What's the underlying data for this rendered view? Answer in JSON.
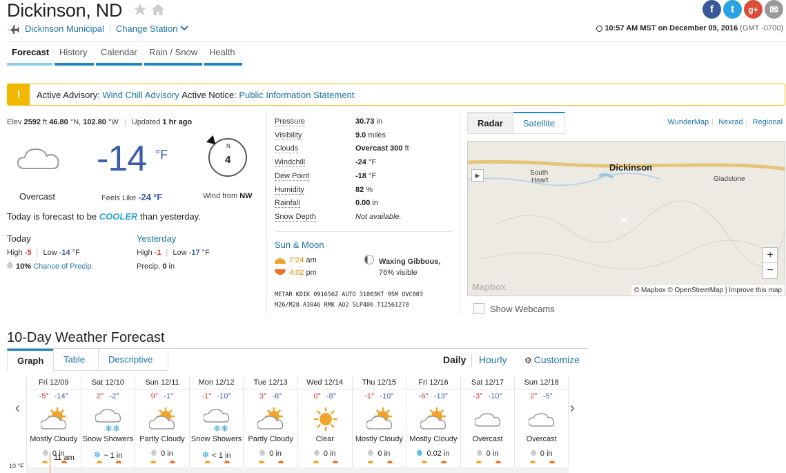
{
  "header": {
    "city": "Dickinson, ND",
    "station": "Dickinson Municipal",
    "change_station": "Change Station",
    "timestamp": "10:57 AM MST on December 09, 2016",
    "gmt": "(GMT -0700)"
  },
  "social": [
    "f",
    "t",
    "g+",
    "✉"
  ],
  "tabs": [
    "Forecast",
    "History",
    "Calendar",
    "Rain / Snow",
    "Health"
  ],
  "advisory": {
    "label1": "Active Advisory:",
    "link1": "Wind Chill Advisory",
    "label2": "Active Notice:",
    "link2": "Public Information Statement"
  },
  "current": {
    "elev_label": "Elev",
    "elev": "2592",
    "elev_unit": "ft",
    "lat": "46.80",
    "lat_dir": "°N,",
    "lon": "102.80",
    "lon_dir": "°W",
    "updated_label": "Updated",
    "updated": "1 hr ago",
    "condition": "Overcast",
    "temp": "-14",
    "temp_unit": "°F",
    "feels_label": "Feels Like",
    "feels": "-24",
    "feels_unit": "°F",
    "wind_dir_letter": "N",
    "wind_speed": "4",
    "wind_from_label": "Wind from",
    "wind_from": "NW",
    "forecast_pre": "Today is forecast to be",
    "forecast_word": "COOLER",
    "forecast_post": "than yesterday."
  },
  "today": {
    "title": "Today",
    "high_label": "High",
    "high": "-5",
    "low_label": "Low",
    "low": "-14",
    "unit": "°F",
    "precip_pct": "10%",
    "precip_label": "Chance of Precip."
  },
  "yesterday": {
    "title": "Yesterday",
    "high_label": "High",
    "high": "-1",
    "low_label": "Low",
    "low": "-17",
    "unit": "°F",
    "precip_label": "Precip.",
    "precip": "0",
    "precip_unit": "in"
  },
  "metrics": [
    {
      "label": "Pressure",
      "value": "30.73",
      "unit": "in"
    },
    {
      "label": "Visibility",
      "value": "9.0",
      "unit": "miles"
    },
    {
      "label": "Clouds",
      "value": "Overcast 300",
      "unit": "ft"
    },
    {
      "label": "Windchill",
      "value": "-24",
      "unit": "°F"
    },
    {
      "label": "Dew Point",
      "value": "-18",
      "unit": "°F"
    },
    {
      "label": "Humidity",
      "value": "82",
      "unit": "%"
    },
    {
      "label": "Rainfall",
      "value": "0.00",
      "unit": "in"
    },
    {
      "label": "Snow Depth",
      "value": "Not available.",
      "unit": ""
    }
  ],
  "sun_moon": {
    "title": "Sun & Moon",
    "sunrise": "7:24",
    "sunrise_ampm": "am",
    "sunset": "4:02",
    "sunset_ampm": "pm",
    "moon_phase": "Waxing Gibbous,",
    "moon_visible": "76%",
    "moon_visible_label": "visible"
  },
  "metar": {
    "line1": "METAR KDIK 091656Z AUTO 31003KT 9SM OVC003",
    "line2": "M26/M28 A3046 RMK AO2 SLP406 T12561278"
  },
  "radar": {
    "tabs": [
      "Radar",
      "Satellite"
    ],
    "links": [
      "WunderMap",
      "Nexrad",
      "Regional"
    ],
    "city": "Dickinson",
    "towns": [
      "South",
      "Heart",
      "Gladstone"
    ],
    "zoom_in": "+",
    "zoom_out": "−",
    "logo": "Mapbox",
    "attribution": "© Mapbox © OpenStreetMap | Improve this map",
    "webcams": "Show Webcams"
  },
  "ten_day": {
    "title": "10-Day Weather Forecast",
    "tabs": [
      "Graph",
      "Table",
      "Descriptive"
    ],
    "daily": "Daily",
    "hourly": "Hourly",
    "customize": "Customize",
    "axis_label": "10 °F",
    "hour_marker": "11 am",
    "days": [
      {
        "name": "Fri 12/09",
        "hi": "-5°",
        "lo": "-14°",
        "cond": "Mostly Cloudy",
        "precip": "0 in",
        "icon": "partly-cloudy-icon"
      },
      {
        "name": "Sat 12/10",
        "hi": "2°",
        "lo": "-2°",
        "cond": "Snow Showers",
        "precip": "~ 1 in",
        "icon": "snow-icon"
      },
      {
        "name": "Sun 12/11",
        "hi": "9°",
        "lo": "-1°",
        "cond": "Partly Cloudy",
        "precip": "0 in",
        "icon": "partly-cloudy-icon"
      },
      {
        "name": "Mon 12/12",
        "hi": "-1°",
        "lo": "-10°",
        "cond": "Snow Showers",
        "precip": "< 1 in",
        "icon": "snow-icon"
      },
      {
        "name": "Tue 12/13",
        "hi": "3°",
        "lo": "-8°",
        "cond": "Partly Cloudy",
        "precip": "0 in",
        "icon": "partly-cloudy-icon"
      },
      {
        "name": "Wed 12/14",
        "hi": "0°",
        "lo": "-8°",
        "cond": "Clear",
        "precip": "0 in",
        "icon": "sun-icon"
      },
      {
        "name": "Thu 12/15",
        "hi": "-1°",
        "lo": "-10°",
        "cond": "Mostly Cloudy",
        "precip": "0 in",
        "icon": "partly-cloudy-icon"
      },
      {
        "name": "Fri 12/16",
        "hi": "-6°",
        "lo": "-13°",
        "cond": "Mostly Cloudy",
        "precip": "0.02 in",
        "icon": "partly-cloudy-icon"
      },
      {
        "name": "Sat 12/17",
        "hi": "-3°",
        "lo": "-10°",
        "cond": "Overcast",
        "precip": "0 in",
        "icon": "cloud-icon"
      },
      {
        "name": "Sun 12/18",
        "hi": "2°",
        "lo": "-5°",
        "cond": "Overcast",
        "precip": "0 in",
        "icon": "cloud-icon"
      }
    ]
  }
}
